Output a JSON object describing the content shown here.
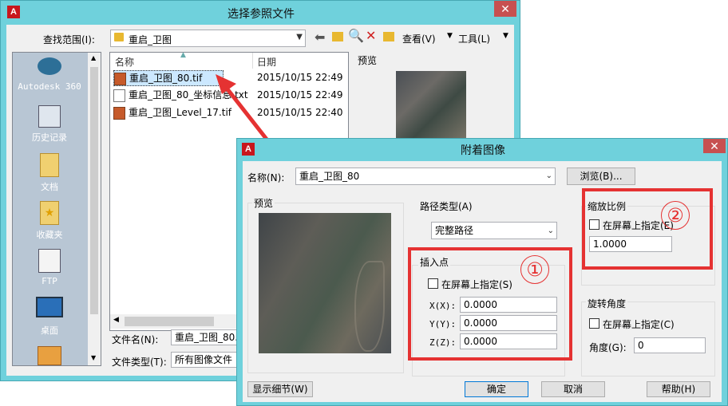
{
  "select_dialog": {
    "title": "选择参照文件",
    "look_in_label": "查找范围(I):",
    "look_in_value": "重启_卫图",
    "view_label": "查看(V)",
    "tools_label": "工具(L)",
    "sidebar": [
      {
        "label": "Autodesk 360",
        "icon": "cloud-icon"
      },
      {
        "label": "历史记录",
        "icon": "history-icon"
      },
      {
        "label": "文档",
        "icon": "documents-icon"
      },
      {
        "label": "收藏夹",
        "icon": "favorites-icon"
      },
      {
        "label": "FTP",
        "icon": "ftp-icon"
      },
      {
        "label": "桌面",
        "icon": "desktop-icon"
      }
    ],
    "columns": {
      "name": "名称",
      "date": "日期",
      "preview": "预览"
    },
    "files": [
      {
        "name": "重启_卫图_80.tif",
        "date": "2015/10/15 22:49"
      },
      {
        "name": "重启_卫图_80_坐标信息.txt",
        "date": "2015/10/15 22:49"
      },
      {
        "name": "重启_卫图_Level_17.tif",
        "date": "2015/10/15 22:40"
      }
    ],
    "filename_label": "文件名(N):",
    "filename_value": "重启_卫图_80.",
    "filetype_label": "文件类型(T):",
    "filetype_value": "所有图像文件"
  },
  "attach_dialog": {
    "title": "附着图像",
    "name_label": "名称(N):",
    "name_value": "重启_卫图_80",
    "browse_label": "浏览(B)...",
    "preview_label": "预览",
    "path_type_label": "路径类型(A)",
    "path_type_value": "完整路径",
    "insert_label": "插入点",
    "insert_onscreen": "在屏幕上指定(S)",
    "x_label": "X(X):",
    "x_value": "0.0000",
    "y_label": "Y(Y):",
    "y_value": "0.0000",
    "z_label": "Z(Z):",
    "z_value": "0.0000",
    "scale_label": "缩放比例",
    "scale_onscreen": "在屏幕上指定(E)",
    "scale_value": "1.0000",
    "rotation_label": "旋转角度",
    "rotation_onscreen": "在屏幕上指定(C)",
    "angle_label": "角度(G):",
    "angle_value": "0",
    "details_label": "显示细节(W)",
    "ok_label": "确定",
    "cancel_label": "取消",
    "help_label": "帮助(H)"
  },
  "annotations": {
    "marker1": "①",
    "marker2": "②"
  },
  "colors": {
    "title_bar": "#6fd1dc",
    "highlight": "#e53232",
    "selection": "#cce8ff"
  }
}
